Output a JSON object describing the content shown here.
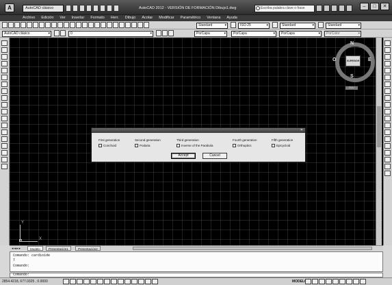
{
  "window": {
    "app_button": "A",
    "workspace": "AutoCAD clásico",
    "title": "AutoCAD 2012 - VERSIÓN DE FORMACIÓN    Dibujo1.dwg",
    "search_placeholder": "Escriba palabra clave o frase",
    "buttons": {
      "minimize": "–",
      "maximize": "□",
      "close": "✕"
    }
  },
  "menu": [
    "Archivo",
    "Edición",
    "Ver",
    "Insertar",
    "Formato",
    "Herr.",
    "Dibujo",
    "Acotar",
    "Modificar",
    "Paramétrico",
    "Ventana",
    "Ayuda"
  ],
  "toolbar1": {
    "text_style": "Standard",
    "dim_style": "ISO-25",
    "table_style": "Standard",
    "multileader_style": "Standard"
  },
  "toolbar2": {
    "workspace": "AutoCAD clásico",
    "layer": "0",
    "color": "PorCapa",
    "linetype": "PorCapa",
    "lineweight": "PorCapa",
    "plotstyle": "PorColor"
  },
  "viewcube": {
    "north": "N",
    "south": "S",
    "east": "E",
    "west": "O",
    "face": "SUPERIOR",
    "wcs": "SCU"
  },
  "ucs": {
    "x": "X",
    "y": "Y"
  },
  "dialog": {
    "columns": [
      {
        "heading": "First generation",
        "option": "Conchoid"
      },
      {
        "heading": "Second generation",
        "option": "Podaria"
      },
      {
        "heading": "Third generation",
        "option": "Inverse of the Parabola"
      },
      {
        "heading": "Fourth generation",
        "option": "Orthoptics"
      },
      {
        "heading": "Fifth generation",
        "option": "Epicycloid"
      }
    ],
    "accept": "Accept",
    "cancel": "Cancel"
  },
  "layout_tabs": [
    "Modelo",
    "Presentación1",
    "Presentación2"
  ],
  "command": {
    "line1": "Comando: cardioide",
    "line2": "T",
    "line3": "Comando:",
    "prompt": "Comando:"
  },
  "status": {
    "coords": "2854.4218, 677.0325 , 0.0000",
    "model": "MODELO"
  }
}
